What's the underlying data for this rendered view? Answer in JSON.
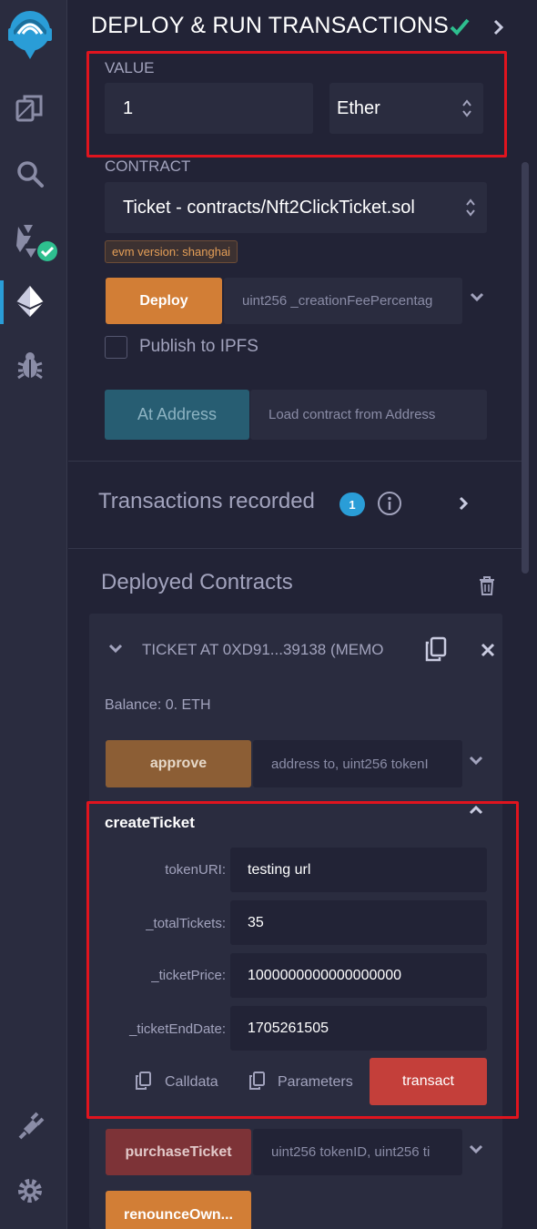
{
  "header": {
    "title": "DEPLOY & RUN TRANSACTIONS"
  },
  "value": {
    "label": "VALUE",
    "amount": "1",
    "unit": "Ether"
  },
  "contract": {
    "label": "CONTRACT",
    "selected": "Ticket - contracts/Nft2ClickTicket.sol",
    "evm_badge": "evm version: shanghai"
  },
  "deploy": {
    "button": "Deploy",
    "params_placeholder": "uint256 _creationFeePercentag"
  },
  "publish": {
    "label": "Publish to IPFS"
  },
  "at_address": {
    "button": "At Address",
    "placeholder": "Load contract from Address"
  },
  "transactions": {
    "label": "Transactions recorded",
    "count": "1"
  },
  "deployed": {
    "label": "Deployed Contracts",
    "instance_title": "TICKET AT 0XD91...39138 (MEMO",
    "balance": "Balance: 0. ETH",
    "approve": {
      "button": "approve",
      "placeholder": "address to, uint256 tokenI"
    },
    "create_ticket": {
      "title": "createTicket",
      "fields": [
        {
          "label": "tokenURI:",
          "value": "testing url"
        },
        {
          "label": "_totalTickets:",
          "value": "35"
        },
        {
          "label": "_ticketPrice:",
          "value": "1000000000000000000"
        },
        {
          "label": "_ticketEndDate:",
          "value": "1705261505"
        }
      ],
      "calldata": "Calldata",
      "parameters": "Parameters",
      "transact": "transact"
    },
    "purchase": {
      "button": "purchaseTicket",
      "placeholder": "uint256 tokenID, uint256 ti"
    },
    "renounce": {
      "button": "renounceOwn..."
    }
  },
  "colors": {
    "accent_orange": "#d27e36",
    "transact_red": "#c43f3a",
    "highlight_red": "#e0141e",
    "success_green": "#2ebf8f",
    "badge_blue": "#2a9dd7"
  }
}
